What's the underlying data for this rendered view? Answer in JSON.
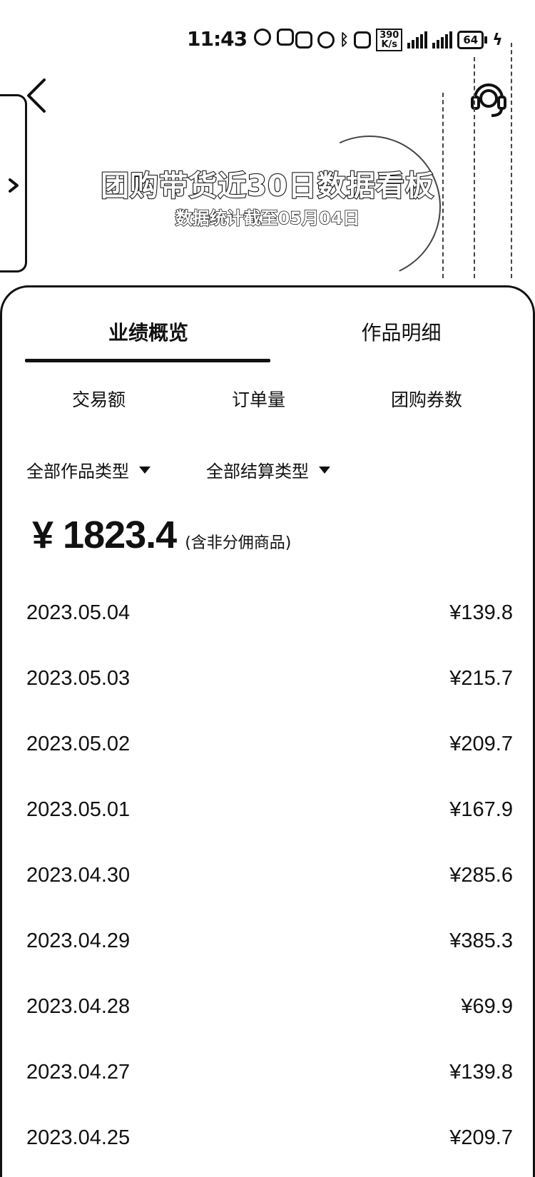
{
  "status_bar": {
    "time": "11:43",
    "net_speed_value": "390",
    "net_speed_unit": "K/s",
    "battery": "64"
  },
  "banner": {
    "title": "团购带货近30日数据看板",
    "subtitle": "数据统计截至05月04日"
  },
  "tabs": [
    {
      "label": "业绩概览",
      "selected": true
    },
    {
      "label": "作品明细",
      "selected": false
    }
  ],
  "metric_tabs": [
    "交易额",
    "订单量",
    "团购券数"
  ],
  "filters": [
    "全部作品类型",
    "全部结算类型"
  ],
  "total": {
    "amount": "¥ 1823.4",
    "note": "(含非分佣商品)"
  },
  "rows": [
    {
      "date": "2023.05.04",
      "amount": "¥139.8"
    },
    {
      "date": "2023.05.03",
      "amount": "¥215.7"
    },
    {
      "date": "2023.05.02",
      "amount": "¥209.7"
    },
    {
      "date": "2023.05.01",
      "amount": "¥167.9"
    },
    {
      "date": "2023.04.30",
      "amount": "¥285.6"
    },
    {
      "date": "2023.04.29",
      "amount": "¥385.3"
    },
    {
      "date": "2023.04.28",
      "amount": "¥69.9"
    },
    {
      "date": "2023.04.27",
      "amount": "¥139.8"
    },
    {
      "date": "2023.04.25",
      "amount": "¥209.7"
    }
  ]
}
